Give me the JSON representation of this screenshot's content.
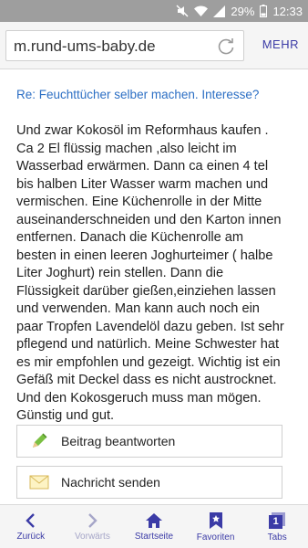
{
  "status": {
    "battery": "29%",
    "time": "12:33"
  },
  "browser": {
    "url": "m.rund-ums-baby.de",
    "menu_label": "MEHR"
  },
  "post": {
    "subject": "Re: Feuchttücher selber machen. Interesse?",
    "body": "Und zwar Kokosöl im Reformhaus kaufen .\nCa 2 El flüssig machen ,also leicht im\nWasserbad erwärmen. Dann ca einen 4 tel\nbis halben Liter Wasser warm machen und\nvermischen. Eine Küchenrolle in der Mitte\nauseinanderschneiden und den Karton innen\nentfernen. Danach die Küchenrolle am\nbesten in einen leeren Joghurteimer ( halbe\nLiter Joghurt) rein stellen. Dann die\nFlüssigkeit darüber gießen,einziehen lassen\nund verwenden. Man kann auch noch ein\npaar Tropfen Lavendelöl dazu geben. Ist sehr\npflegend und natürlich. Meine Schwester hat\nes mir empfohlen und gezeigt. Wichtig ist ein\nGefäß mit Deckel dass es nicht austrocknet.\nUnd den Kokosgeruch muss man mögen.\nGünstig und gut."
  },
  "actions": {
    "reply_label": "Beitrag beantworten",
    "message_label": "Nachricht senden"
  },
  "nav": {
    "back": "Zurück",
    "forward": "Vorwärts",
    "home": "Startseite",
    "favorites": "Favoriten",
    "tabs": "Tabs",
    "tabs_count": "1"
  },
  "colors": {
    "accent": "#3b3ba6",
    "link": "#2c6fc4",
    "status_bar": "#9e9e9e"
  }
}
